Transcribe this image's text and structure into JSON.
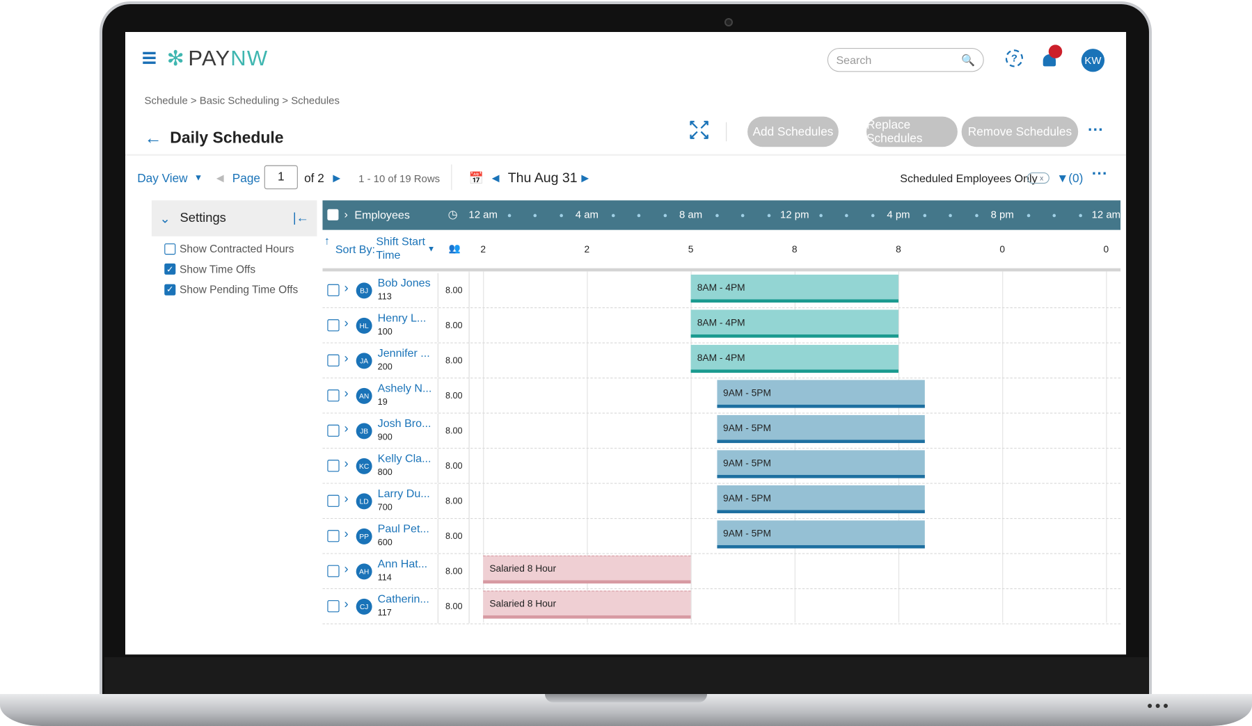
{
  "app": {
    "brand_left": "PAY",
    "brand_right": "NW",
    "search_placeholder": "Search",
    "avatar_initials": "KW"
  },
  "breadcrumb": "Schedule > Basic Scheduling > Schedules",
  "page_title": "Daily Schedule",
  "actions": {
    "add": "Add Schedules",
    "replace": "Replace Schedules",
    "remove": "Remove Schedules"
  },
  "toolbar": {
    "view": "Day View",
    "page_label": "Page",
    "page_value": "1",
    "page_of": "of 2",
    "rows_info": "1 - 10 of 19 Rows",
    "date": "Thu Aug 31",
    "scheduled_only": "Scheduled Employees Only",
    "toggle_state": "x",
    "filter_count": "(0)"
  },
  "settings": {
    "title": "Settings",
    "options": [
      {
        "label": "Show Contracted Hours",
        "checked": false
      },
      {
        "label": "Show Time Offs",
        "checked": true
      },
      {
        "label": "Show Pending Time Offs",
        "checked": true
      }
    ]
  },
  "grid": {
    "employees_label": "Employees",
    "sort_by": "Sort By:",
    "sort_field": "Shift Start Time",
    "ticks": [
      "12 am",
      "4 am",
      "8 am",
      "12 pm",
      "4 pm",
      "8 pm",
      "12 am"
    ],
    "counts": [
      "2",
      "2",
      "5",
      "8",
      "8",
      "0",
      "0"
    ],
    "colors": {
      "header": "#44778a",
      "shift_early": "#93d5d3",
      "shift_late": "#95c0d4",
      "time_off": "#efcfd3"
    },
    "rows": [
      {
        "initials": "BJ",
        "name": "Bob Jones",
        "id": "113",
        "hours": "8.00",
        "shift": {
          "label": "8AM - 4PM",
          "start": 8,
          "end": 16,
          "type": "early"
        }
      },
      {
        "initials": "HL",
        "name": "Henry L...",
        "id": "100",
        "hours": "8.00",
        "shift": {
          "label": "8AM - 4PM",
          "start": 8,
          "end": 16,
          "type": "early"
        }
      },
      {
        "initials": "JA",
        "name": "Jennifer ...",
        "id": "200",
        "hours": "8.00",
        "shift": {
          "label": "8AM - 4PM",
          "start": 8,
          "end": 16,
          "type": "early"
        }
      },
      {
        "initials": "AN",
        "name": "Ashely N...",
        "id": "19",
        "hours": "8.00",
        "shift": {
          "label": "9AM - 5PM",
          "start": 9,
          "end": 17,
          "type": "late"
        }
      },
      {
        "initials": "JB",
        "name": "Josh Bro...",
        "id": "900",
        "hours": "8.00",
        "shift": {
          "label": "9AM - 5PM",
          "start": 9,
          "end": 17,
          "type": "late"
        }
      },
      {
        "initials": "KC",
        "name": "Kelly Cla...",
        "id": "800",
        "hours": "8.00",
        "shift": {
          "label": "9AM - 5PM",
          "start": 9,
          "end": 17,
          "type": "late"
        }
      },
      {
        "initials": "LD",
        "name": "Larry Du...",
        "id": "700",
        "hours": "8.00",
        "shift": {
          "label": "9AM - 5PM",
          "start": 9,
          "end": 17,
          "type": "late"
        }
      },
      {
        "initials": "PP",
        "name": "Paul Pet...",
        "id": "600",
        "hours": "8.00",
        "shift": {
          "label": "9AM - 5PM",
          "start": 9,
          "end": 17,
          "type": "late"
        }
      },
      {
        "initials": "AH",
        "name": "Ann Hat...",
        "id": "114",
        "hours": "8.00",
        "shift": {
          "label": "Salaried 8 Hour",
          "start": 0,
          "end": 8,
          "type": "timeoff"
        }
      },
      {
        "initials": "CJ",
        "name": "Catherin...",
        "id": "117",
        "hours": "8.00",
        "shift": {
          "label": "Salaried 8 Hour",
          "start": 0,
          "end": 8,
          "type": "timeoff"
        }
      }
    ]
  }
}
